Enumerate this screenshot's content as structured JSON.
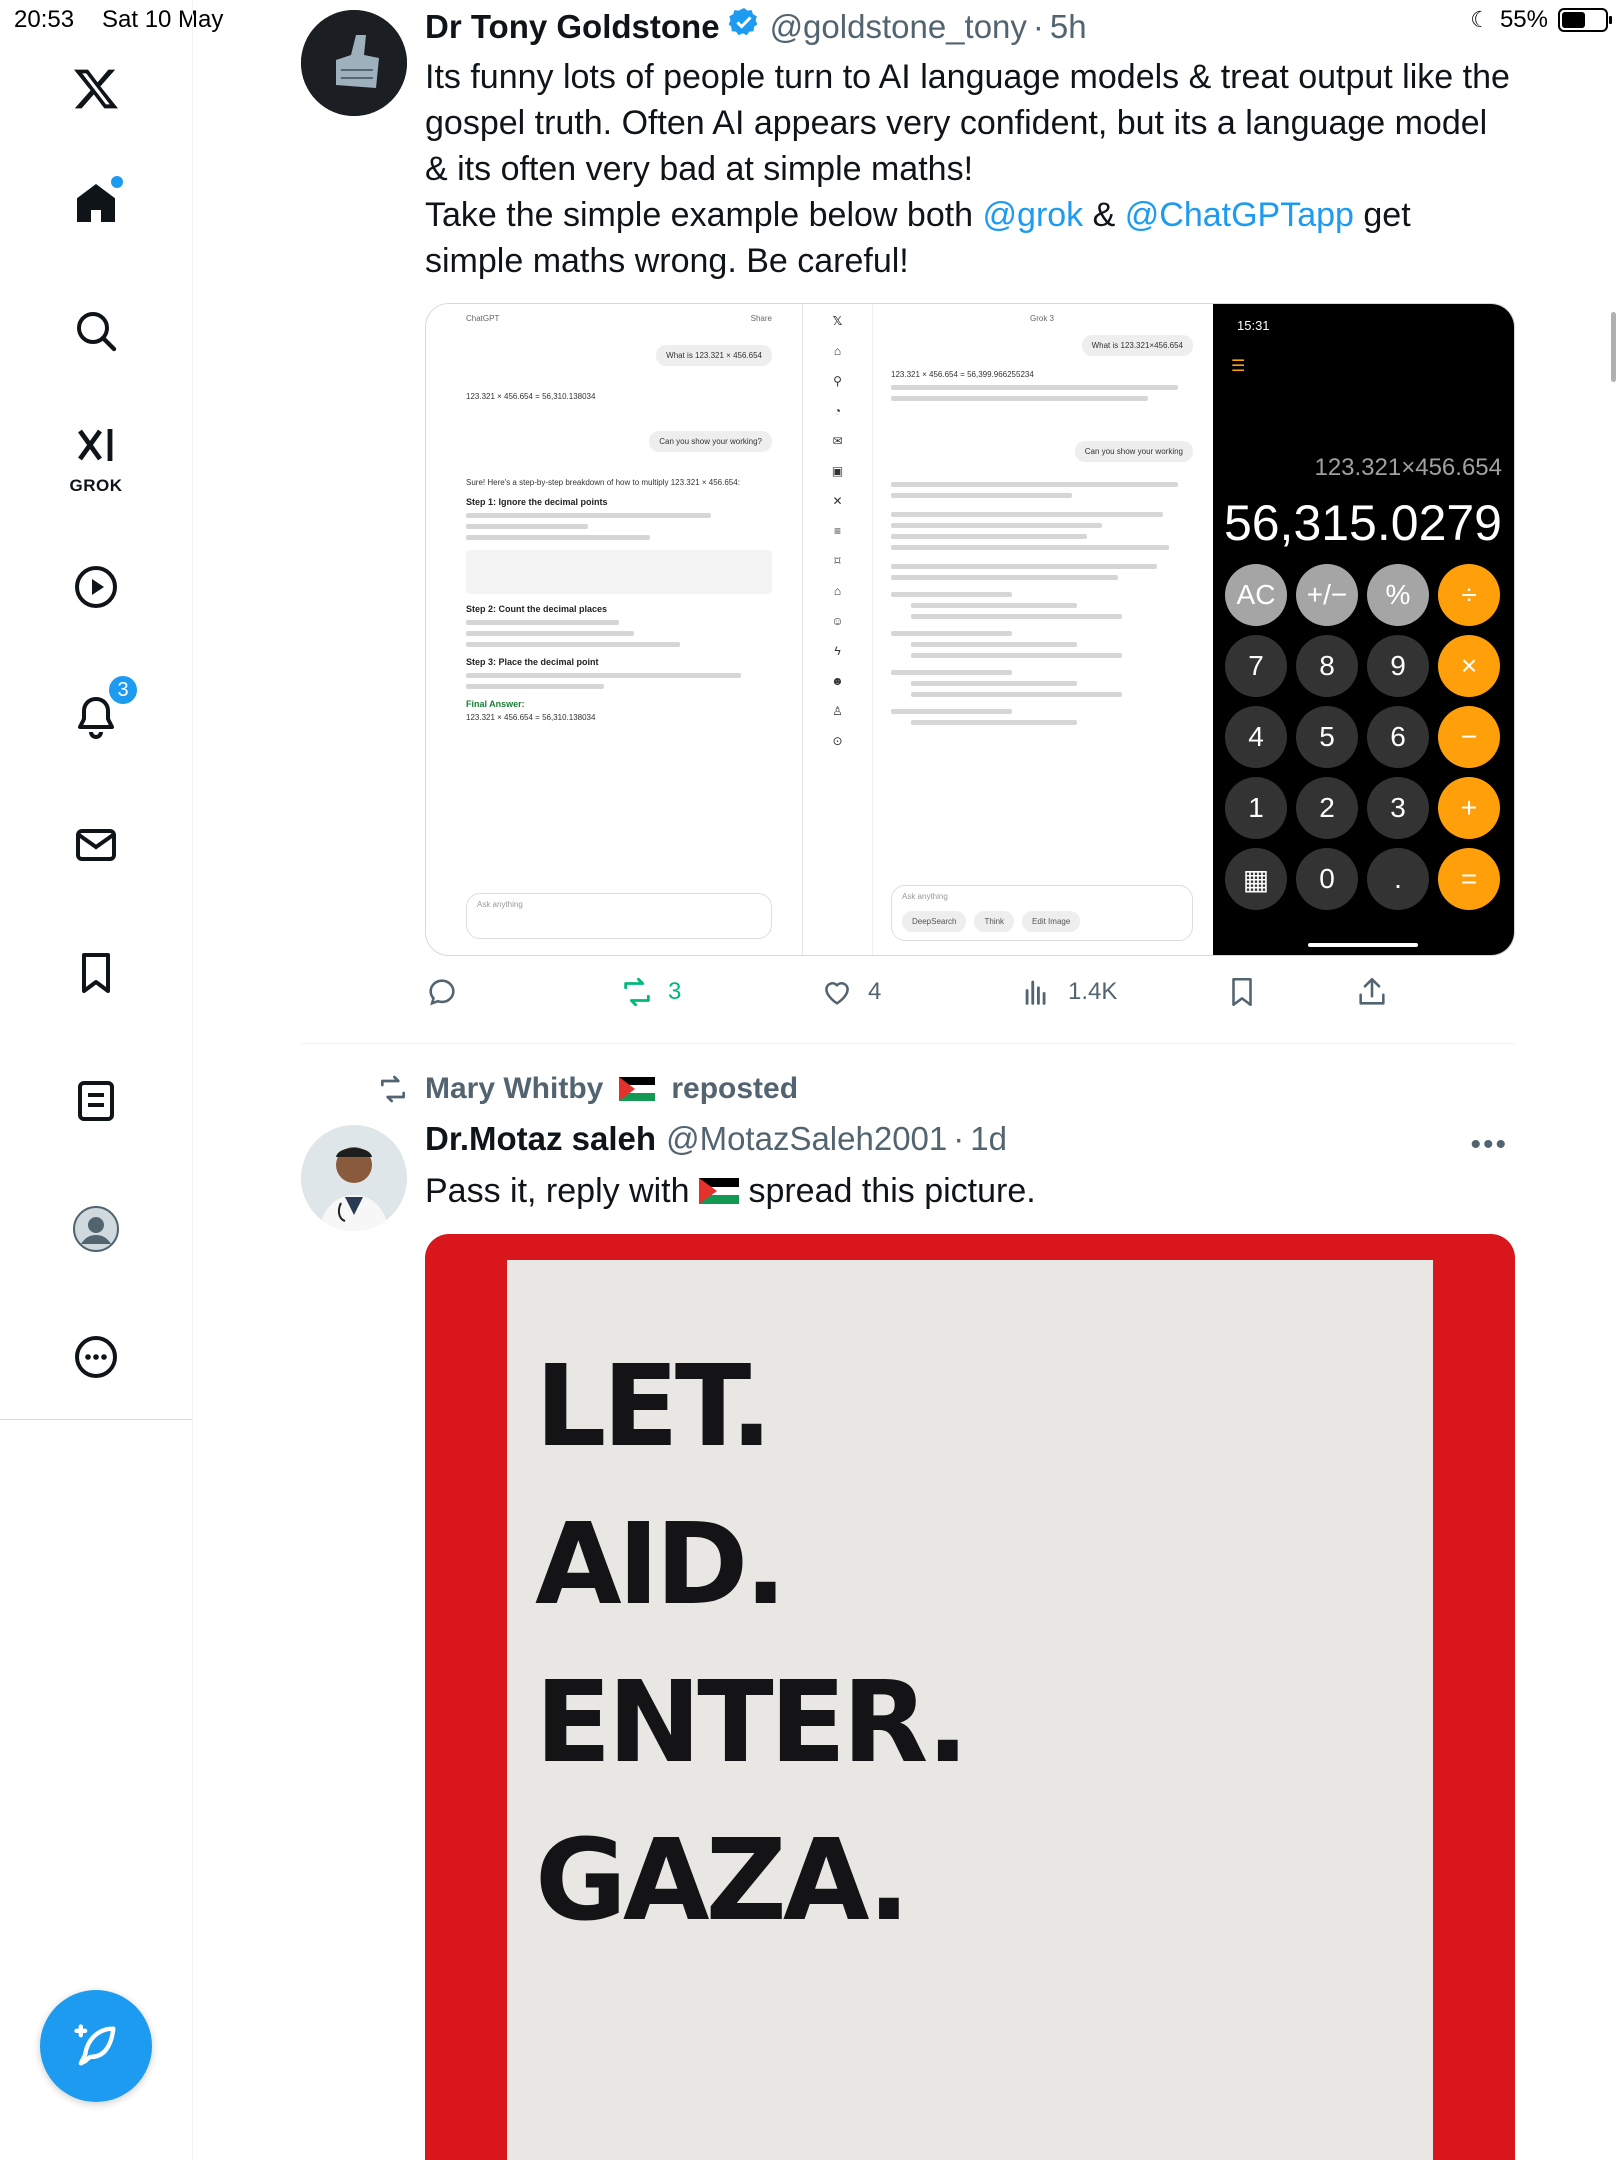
{
  "status_bar": {
    "time": "20:53",
    "date": "Sat 10 May",
    "battery": "55%",
    "battery_level": 0.55
  },
  "sidebar": {
    "grok_label": "GROK",
    "notifications_badge": "3"
  },
  "tweet1": {
    "name": "Dr Tony Goldstone",
    "handle": "@goldstone_tony",
    "time": "5h",
    "text_line1": "Its funny lots of people turn to AI language models & treat output like the gospel truth. Often AI appears very confident, but its a language model & its often very bad at simple maths!",
    "text_line2_pre": "Take the simple example below both ",
    "mention1": "@grok",
    "text_line2_mid": " & ",
    "mention2": "@ChatGPTapp",
    "text_line2_post": " get simple maths wrong. Be careful!",
    "media": {
      "gpt": {
        "header": "ChatGPT",
        "share": "Share",
        "user_q": "What is 123.321 × 456.654",
        "answer": "123.321 × 456.654 = 56,310.138034",
        "user_q2": "Can you show your working?",
        "intro": "Sure! Here's a step-by-step breakdown of how to multiply 123.321 × 456.654:",
        "step1": "Step 1: Ignore the decimal points",
        "step2": "Step 2: Count the decimal places",
        "step3": "Step 3: Place the decimal point",
        "final": "Final Answer:",
        "final_value": "123.321 × 456.654 = 56,310.138034",
        "ask": "Ask anything"
      },
      "grok": {
        "header": "Grok 3",
        "user_q": "What is 123.321×456.654",
        "answer": "123.321 × 456.654 = 56,399.966255234",
        "user_q2": "Can you show your working",
        "ask": "Ask anything",
        "deepsearch": "DeepSearch",
        "think": "Think",
        "edit_image": "Edit Image"
      },
      "calc": {
        "time": "15:31",
        "expression": "123.321×456.654",
        "result": "56,315.0279",
        "keys": [
          "AC",
          "+/−",
          "%",
          "÷",
          "7",
          "8",
          "9",
          "×",
          "4",
          "5",
          "6",
          "−",
          "1",
          "2",
          "3",
          "+",
          "▦",
          "0",
          ".",
          "="
        ]
      }
    },
    "replies": "",
    "reposts": "3",
    "likes": "4",
    "views": "1.4K"
  },
  "tweet2": {
    "repost_by": "Mary Whitby",
    "repost_suffix": "reposted",
    "name": "Dr.Motaz saleh",
    "handle": "@MotazSaleh2001",
    "time": "1d",
    "text_pre": "Pass it, reply with ",
    "text_post": " spread this picture.",
    "poster_lines": [
      "LET.",
      "AID.",
      "ENTER.",
      "GAZA."
    ],
    "more": "•••"
  }
}
